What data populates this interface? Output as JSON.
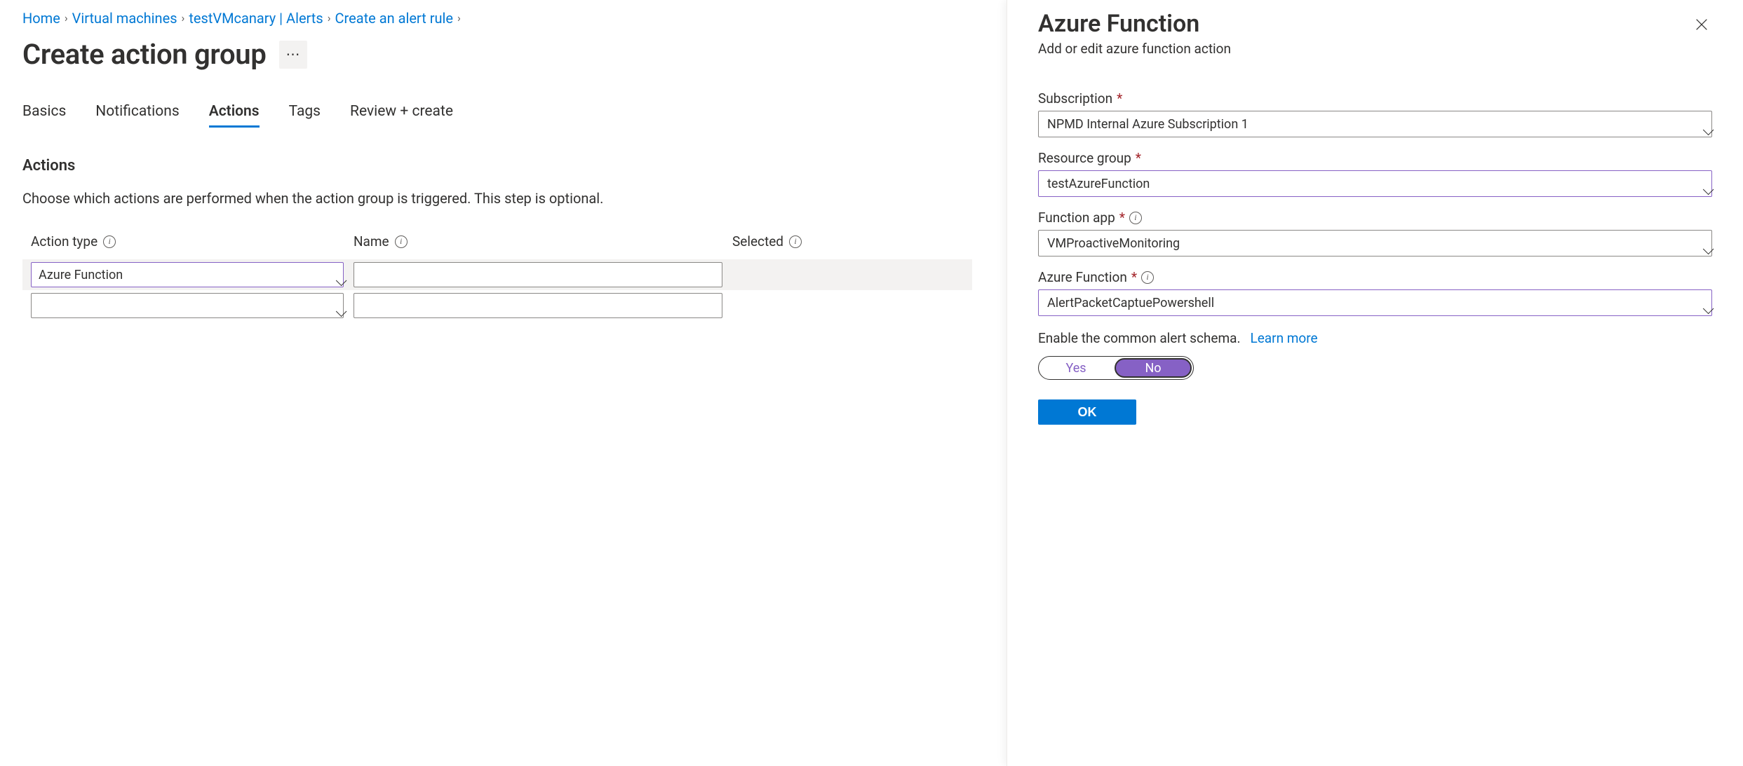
{
  "breadcrumb": [
    {
      "label": "Home",
      "link": true
    },
    {
      "label": "Virtual machines",
      "link": true
    },
    {
      "label": "testVMcanary | Alerts",
      "link": true
    },
    {
      "label": "Create an alert rule",
      "link": true
    }
  ],
  "page": {
    "title": "Create action group",
    "more_label": "⋯"
  },
  "tabs": [
    {
      "label": "Basics",
      "active": false
    },
    {
      "label": "Notifications",
      "active": false
    },
    {
      "label": "Actions",
      "active": true
    },
    {
      "label": "Tags",
      "active": false
    },
    {
      "label": "Review + create",
      "active": false
    }
  ],
  "section": {
    "heading": "Actions",
    "description": "Choose which actions are performed when the action group is triggered. This step is optional."
  },
  "actions_table": {
    "headers": {
      "type": "Action type",
      "name": "Name",
      "selected": "Selected"
    },
    "rows": [
      {
        "type_value": "Azure Function",
        "name_value": "",
        "highlight": true,
        "purple": true
      },
      {
        "type_value": "",
        "name_value": "",
        "highlight": false,
        "purple": false
      }
    ]
  },
  "panel": {
    "title": "Azure Function",
    "subtitle": "Add or edit azure function action",
    "fields": {
      "subscription": {
        "label": "Subscription",
        "value": "NPMD Internal Azure Subscription 1",
        "required": true,
        "info": false,
        "purple": false
      },
      "resource_group": {
        "label": "Resource group",
        "value": "testAzureFunction",
        "required": true,
        "info": false,
        "purple": true
      },
      "function_app": {
        "label": "Function app",
        "value": "VMProactiveMonitoring",
        "required": true,
        "info": true,
        "purple": false
      },
      "azure_function": {
        "label": "Azure Function",
        "value": "AlertPacketCaptuePowershell",
        "required": true,
        "info": true,
        "purple": true
      }
    },
    "schema": {
      "text": "Enable the common alert schema.",
      "link": "Learn more"
    },
    "toggle": {
      "yes": "Yes",
      "no": "No",
      "selected": "No"
    },
    "ok": "OK"
  }
}
